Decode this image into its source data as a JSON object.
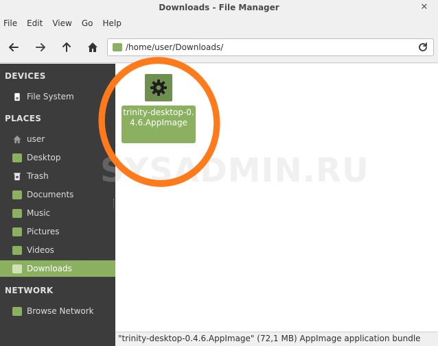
{
  "window": {
    "title": "Downloads - File Manager",
    "close_glyph": "✕"
  },
  "menu": [
    "File",
    "Edit",
    "View",
    "Go",
    "Help"
  ],
  "toolbar": {
    "location_path": "/home/user/Downloads/",
    "icons": [
      "back-arrow-icon",
      "forward-arrow-icon",
      "up-arrow-icon",
      "home-icon",
      "reload-icon"
    ]
  },
  "sidebar": {
    "devices_header": "DEVICES",
    "devices": [
      {
        "label": "File System",
        "icon": "drive-icon"
      }
    ],
    "places_header": "PLACES",
    "places": [
      {
        "label": "user",
        "icon": "home-icon"
      },
      {
        "label": "Desktop",
        "icon": "folder-icon"
      },
      {
        "label": "Trash",
        "icon": "trash-icon"
      },
      {
        "label": "Documents",
        "icon": "folder-icon"
      },
      {
        "label": "Music",
        "icon": "folder-icon"
      },
      {
        "label": "Pictures",
        "icon": "folder-icon"
      },
      {
        "label": "Videos",
        "icon": "folder-icon"
      },
      {
        "label": "Downloads",
        "icon": "folder-icon",
        "active": true
      }
    ],
    "network_header": "NETWORK",
    "network": [
      {
        "label": "Browse Network",
        "icon": "network-icon"
      }
    ]
  },
  "main": {
    "files": [
      {
        "name": "trinity-desktop-0.4.6.AppImage",
        "icon": "gear-icon",
        "selected": true
      }
    ],
    "watermark": "SYSADMIN.RU"
  },
  "status": {
    "text": "\"trinity-desktop-0.4.6.AppImage\" (72,1 MB) AppImage application bundle"
  },
  "colors": {
    "accent": "#8ab060",
    "sidebar_bg": "#3c3c3c",
    "highlight_ring": "#ff7a1a"
  }
}
